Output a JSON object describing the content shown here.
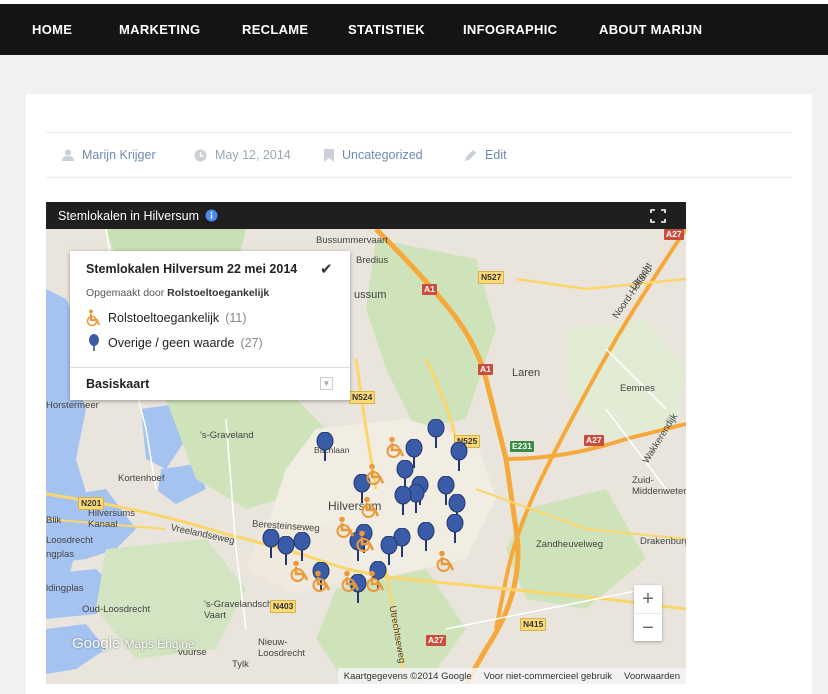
{
  "nav": {
    "items": [
      "HOME",
      "MARKETING",
      "RECLAME",
      "STATISTIEK",
      "INFOGRAPHIC",
      "ABOUT MARIJN"
    ]
  },
  "meta": {
    "author": "Marijn Krijger",
    "date": "May 12, 2014",
    "category": "Uncategorized",
    "edit": "Edit"
  },
  "map": {
    "title": "Stemlokalen in Hilversum",
    "legend": {
      "title": "Stemlokalen Hilversum 22 mei 2014",
      "made_by_prefix": "Opgemaakt door",
      "made_by": "Rolstoeltoegankelijk",
      "rows": [
        {
          "label": "Rolstoeltoegankelijk",
          "count": "(11)"
        },
        {
          "label": "Overige / geen waarde",
          "count": "(27)"
        }
      ],
      "base": "Basiskaart"
    },
    "zoom_in": "+",
    "zoom_out": "−",
    "branding": "Google",
    "branding_sub": "Maps Engine",
    "attribution": [
      "Kaartgegevens ©2014 Google",
      "Voor niet-commercieel gebruik",
      "Voorwaarden"
    ],
    "labels": {
      "hilversum": "Hilversum",
      "laren": "Laren",
      "eemnes": "Eemnes",
      "s_graveland": "'s-Graveland",
      "kortenhoef": "Kortenhoef",
      "loosdrecht": "Loosdrecht",
      "oud_loosdrecht": "Oud-Loosdrecht",
      "nieuw_loosdrecht": "Nieuw-\nLoosdrecht",
      "zuid_middenwetering": "Zuid-\nMiddenwetering",
      "bussummervaart": "Bussummervaart",
      "bussum": "ussum",
      "horstermeer": "Horstermeer",
      "hilversums_kanaal": "Hilversums\nKanaal",
      "utrechtseweg": "Utrechtseweg",
      "zandheuvelweg": "Zandheuvelweg",
      "drakenburg": "Drakenburg",
      "vreelandseweg": "Vreelandseweg",
      "beresteinseweg": "Beresteinseweg",
      "s_gravelandsche_vaart": "'s-Gravelandsche\nVaart",
      "noord_holland": "Noord-Holland",
      "utrecht": "Utrecht",
      "bachlaan": "Bachlaan",
      "wakkerendijk": "Wakkerendijk",
      "bredius": "Bredius",
      "blik": "Blik",
      "ldingplas": "ldingplas",
      "ngplas": "ngplas",
      "vuurse": "vuurse",
      "ordsbrug": "Tylk"
    },
    "roads": [
      "N527",
      "A1",
      "A1",
      "N525",
      "E231",
      "A27",
      "N201",
      "N524",
      "N403",
      "A27",
      "N415",
      "A27"
    ]
  }
}
